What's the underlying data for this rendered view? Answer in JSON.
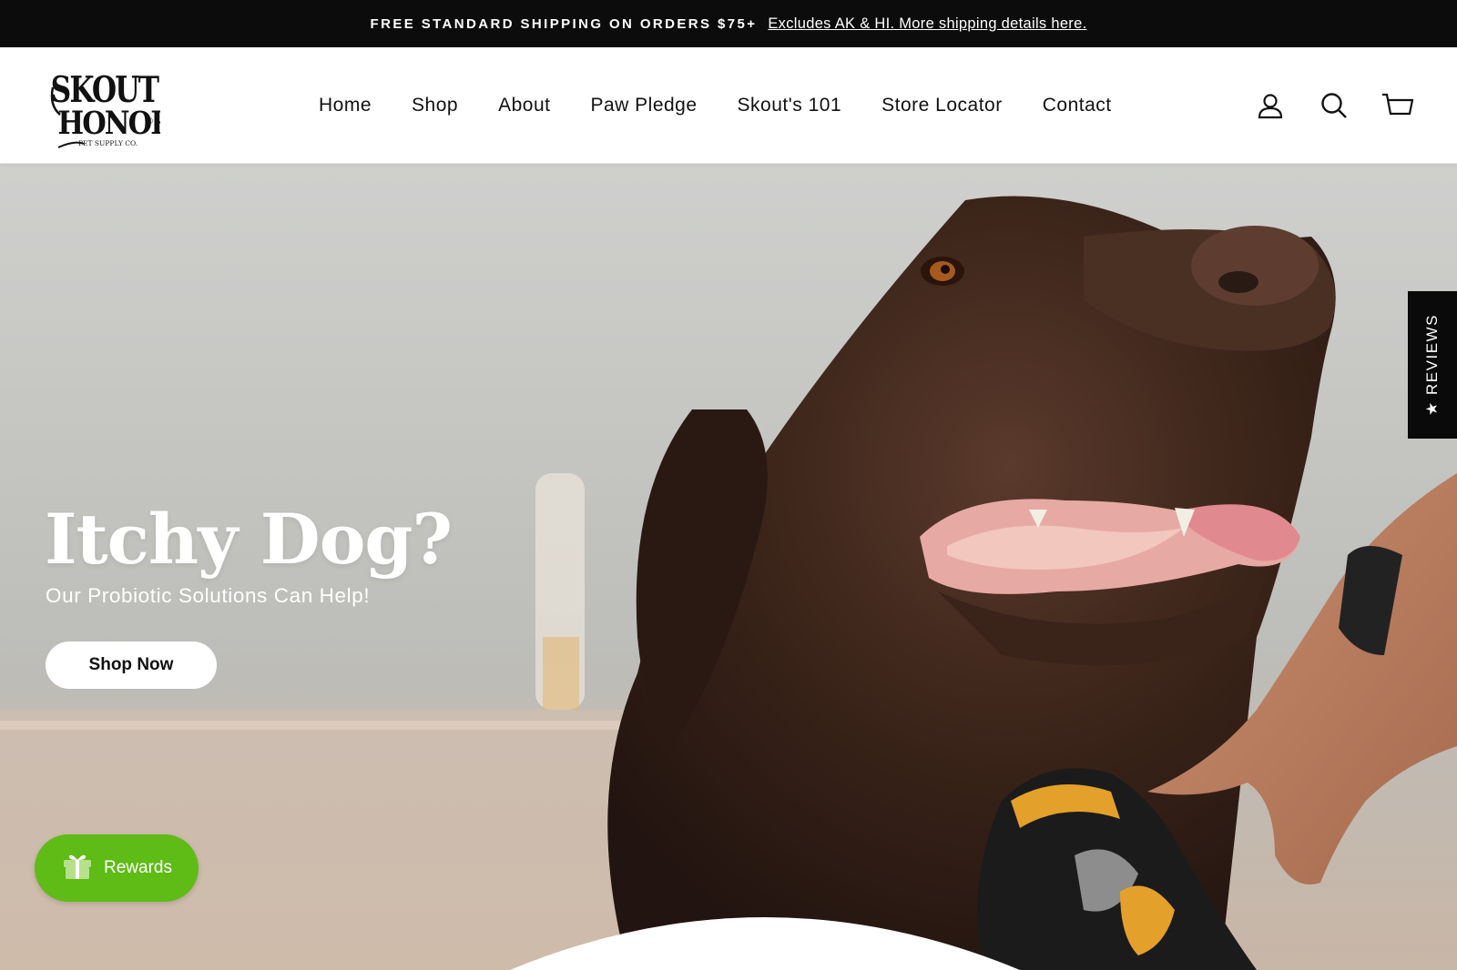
{
  "announcement": {
    "bold_text": "FREE STANDARD SHIPPING ON ORDERS $75+",
    "link_text": "Excludes AK & HI. More shipping details here."
  },
  "header": {
    "logo": {
      "line1": "SKOUT'S",
      "line2": "HONOR",
      "line3": "PET SUPPLY CO.",
      "mark": "®"
    },
    "nav": [
      "Home",
      "Shop",
      "About",
      "Paw Pledge",
      "Skout's 101",
      "Store Locator",
      "Contact"
    ],
    "icons": [
      "account-icon",
      "search-icon",
      "cart-icon"
    ]
  },
  "hero": {
    "title": "Itchy Dog?",
    "subtitle": "Our Probiotic Solutions Can Help!",
    "cta": "Shop Now"
  },
  "reviews_tab": {
    "label": "★ REVIEWS"
  },
  "rewards": {
    "label": "Rewards",
    "icon": "gift-icon",
    "color": "#5fbb16"
  },
  "colors": {
    "announcement_bg": "#0c0c0c",
    "text": "#111111",
    "rewards_green": "#5fbb16"
  }
}
